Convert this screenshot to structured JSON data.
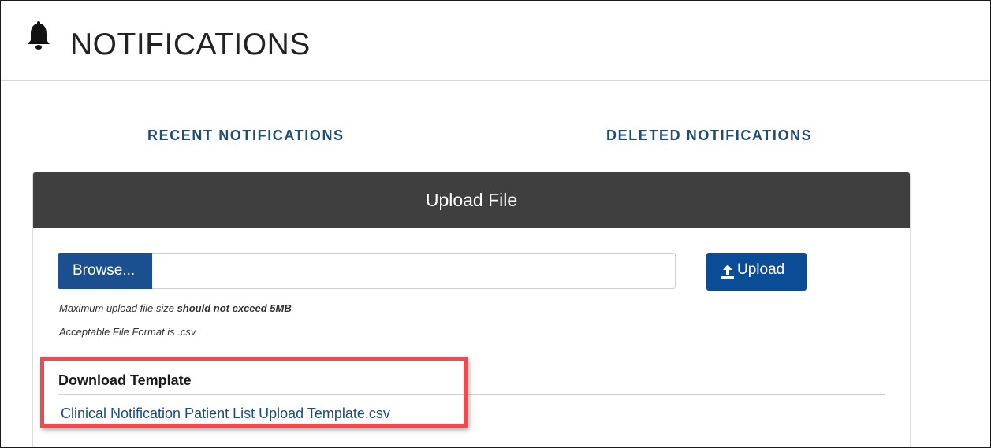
{
  "header": {
    "icon": "bell-icon",
    "title": "NOTIFICATIONS"
  },
  "tabs": {
    "recent": "RECENT NOTIFICATIONS",
    "deleted": "DELETED NOTIFICATIONS"
  },
  "upload_panel": {
    "title": "Upload File",
    "browse_label": "Browse...",
    "file_value": "",
    "upload_label": "Upload",
    "upload_icon": "upload-icon",
    "max_size_prefix": "Maximum upload file size ",
    "max_size_emphasis": "should not exceed 5MB",
    "format_hint": "Acceptable File Format is .csv"
  },
  "download": {
    "title": "Download Template",
    "link_label": "Clinical Notification Patient List Upload Template.csv"
  },
  "colors": {
    "panel_header": "#3f3f3f",
    "primary_button": "#1c4f8f",
    "link": "#1a4c8a",
    "highlight": "#ef4a4f"
  }
}
